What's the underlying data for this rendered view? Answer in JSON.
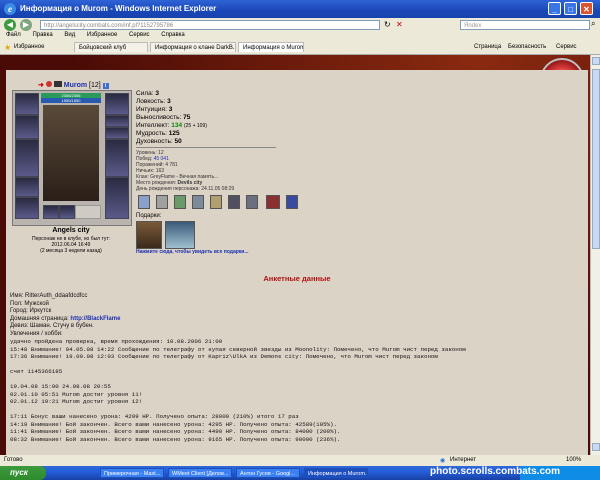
{
  "window": {
    "title": "Информация о Murom - Windows Internet Explorer"
  },
  "address_bar": {
    "url": "http://angelscity.combats.com/inf.pl?1152795786",
    "search_placeholder": "Яndex"
  },
  "menu": [
    "Файл",
    "Правка",
    "Вид",
    "Избранное",
    "Сервис",
    "Справка"
  ],
  "toolbar": {
    "favorites_label": "Избранное",
    "tabs": [
      {
        "label": "Бойцовский клуб"
      },
      {
        "label": "Информация о клане DarkB..."
      },
      {
        "label": "Информация о Murom"
      }
    ],
    "page_menu": "Страница",
    "safety_menu": "Безопасность",
    "service_menu": "Сервис"
  },
  "character": {
    "name": "Murom",
    "level": "[12]",
    "hp": "2356/2356",
    "mana": "1550/1550",
    "city": "Angels city",
    "online_line1": "Персонаж не в клубе, но был тут:",
    "online_line2": "2012.06.04 16:49",
    "online_line3": "(2 месяца 3 недели назад)",
    "stats": [
      {
        "label": "Сила:",
        "value": "3"
      },
      {
        "label": "Ловкость:",
        "value": "3"
      },
      {
        "label": "Интуиция:",
        "value": "3"
      },
      {
        "label": "Выносливость:",
        "value": "75"
      },
      {
        "label": "Интеллект:",
        "value": "134",
        "extra": "(25 + 109)"
      },
      {
        "label": "Мудрость:",
        "value": "125"
      },
      {
        "label": "Духовность:",
        "value": "50"
      }
    ],
    "meta": [
      {
        "label": "Уровень:",
        "value": "12"
      },
      {
        "label": "Побед:",
        "value": "45 041"
      },
      {
        "label": "Поражений:",
        "value": "4 781"
      },
      {
        "label": "Ничьих:",
        "value": "163"
      },
      {
        "label": "Клан:",
        "value": "GreyFlame - Вечная память..."
      },
      {
        "label": "Место рождения:",
        "value": "Devils city"
      },
      {
        "label": "День рождения персонажа:",
        "value": "24.11.05 08:29"
      }
    ],
    "gifts_label": "Подарки:",
    "gifts_link": "Нажмите сюда, чтобы увидеть все подарки..."
  },
  "questionnaire": {
    "heading": "Анкетные данные",
    "lines": [
      "Имя: RitterAuth_ddaafdcdfcc",
      "Пол: Мужской",
      "Город: Иркутск",
      "Домашняя страница: ",
      "Девиз: Шаман. Стучу в бубен.",
      "Увлечения / хобби:",
      "удачно пройдена проверка, время прохождения: 10.08.2006 21:00",
      "15:48 Внимание! 04.05.08 14:22 Сообщение по телеграфу от купая северной звезды из Moonolity: Помечено, что Murom чист перед законом",
      "17:36 Внимание! 19.09.08 12:03 Сообщение по телеграфу от Kapriz\\UlkA из Demons city: Помечено, что Murom чист перед законом",
      "",
      "счет 1145366185",
      "",
      "19.04.08 15:00 24.08.08 20:55",
      "02.01.10 05:51 Murom достиг уровня 11!",
      "02.01.12 19:21 Murom достиг уровня 12!",
      "",
      "17:11 Бонус ваши нанесено урона: 4299 HP. Получено опыта: 28000 (210%) итого 17 раз",
      "14:19 Внимание! Бой закончен. Всего вами нанесено урона: 4295 HP. Получено опыта: 42589(105%).",
      "11:41 Внимание! Бой закончен. Всего вами нанесено урона: 4490 HP. Получено опыта: 84000 (200%).",
      "08:32 Внимание! Бой закончен. Всего вами нанесено урона: 9165 HP. Получено опыта: 90000 (236%)."
    ],
    "homepage_link": "http://BlackFlame"
  },
  "statusbar": {
    "left": "Готово",
    "zone": "Интернет",
    "zoom": "100%"
  },
  "taskbar": {
    "start": "пуск",
    "tasks": [
      {
        "label": "Примерочная - Maxt..."
      },
      {
        "label": "WMeet Client [Делов..."
      },
      {
        "label": "Антон Гусев - Googl..."
      },
      {
        "label": "Информация о Murom..."
      }
    ],
    "watermark": "photo.scrolls.combats.com"
  },
  "colors": {
    "title_blue": "#1a47b8",
    "panel_bg": "#dcd3c7",
    "heading_red": "#b01010",
    "link_blue": "#1a2fb0",
    "green_value": "#0a8a0a"
  }
}
